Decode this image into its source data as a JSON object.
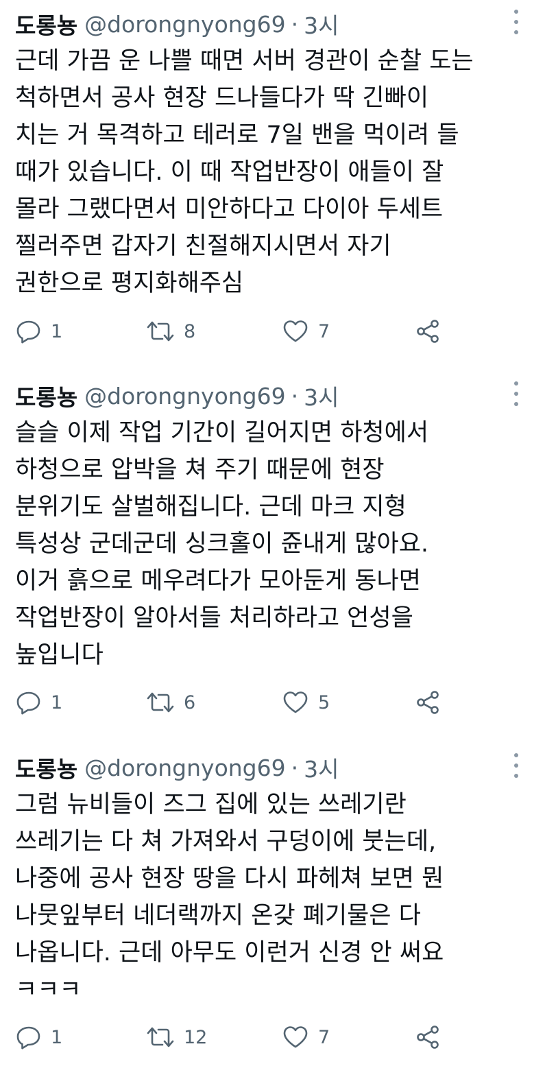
{
  "tweets": [
    {
      "display_name": "도롱뇽",
      "handle": "@dorongnyong69",
      "separator": "·",
      "time": "3시",
      "lines": [
        "근데 가끔 운 나쁠 때면 서버 경관이 순찰 도는",
        "척하면서 공사 현장 드나들다가 딱 긴빠이",
        "치는 거 목격하고 테러로 7일 밴을 먹이려 들",
        "때가 있습니다. 이 때 작업반장이 애들이 잘",
        "몰라 그랬다면서 미안하다고 다이아 두세트",
        "찔러주면 갑자기 친절해지시면서 자기",
        "권한으로 평지화해주심"
      ],
      "reply_count": "1",
      "retweet_count": "8",
      "like_count": "7"
    },
    {
      "display_name": "도롱뇽",
      "handle": "@dorongnyong69",
      "separator": "·",
      "time": "3시",
      "lines": [
        "슬슬 이제 작업 기간이 길어지면 하청에서",
        "하청으로 압박을 쳐 주기 때문에 현장",
        "분위기도 살벌해집니다. 근데 마크 지형",
        "특성상 군데군데 싱크홀이 쥰내게 많아요.",
        "이거 흙으로 메우려다가 모아둔게 동나면",
        "작업반장이 알아서들 처리하라고 언성을",
        "높입니다"
      ],
      "reply_count": "1",
      "retweet_count": "6",
      "like_count": "5"
    },
    {
      "display_name": "도롱뇽",
      "handle": "@dorongnyong69",
      "separator": "·",
      "time": "3시",
      "lines": [
        "그럼 뉴비들이 즈그 집에 있는 쓰레기란",
        "쓰레기는 다 쳐 가져와서 구덩이에 붓는데,",
        "나중에 공사 현장 땅을 다시 파헤쳐 보면 뭔",
        "나뭇잎부터 네더랙까지 온갖 폐기물은 다",
        "나옵니다. 근데 아무도 이런거 신경 안 써요",
        "ㅋㅋㅋ"
      ],
      "reply_count": "1",
      "retweet_count": "12",
      "like_count": "7"
    }
  ],
  "icons": {
    "reply": "reply-icon",
    "retweet": "retweet-icon",
    "like": "like-icon",
    "share": "share-icon",
    "more": "more-options-icon"
  },
  "colors": {
    "text": "#0f1419",
    "secondary": "#536471",
    "background": "#ffffff"
  }
}
